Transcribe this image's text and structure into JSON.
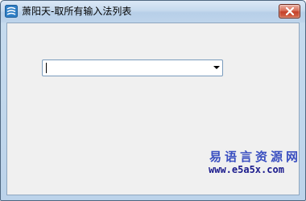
{
  "window": {
    "title": "萧阳天-取所有输入法列表",
    "app_icon": "app-logo-icon",
    "close_icon": "close-icon"
  },
  "combo": {
    "value": "",
    "arrow_icon": "dropdown-arrow-icon"
  },
  "watermark": {
    "site_name": "易语言资源网",
    "url": "www.e5a5x.com"
  },
  "colors": {
    "titlebar": "#c6daee",
    "client_bg": "#f0f0f0",
    "close_button": "#c4402a",
    "watermark_text": "#3a4fc0"
  }
}
